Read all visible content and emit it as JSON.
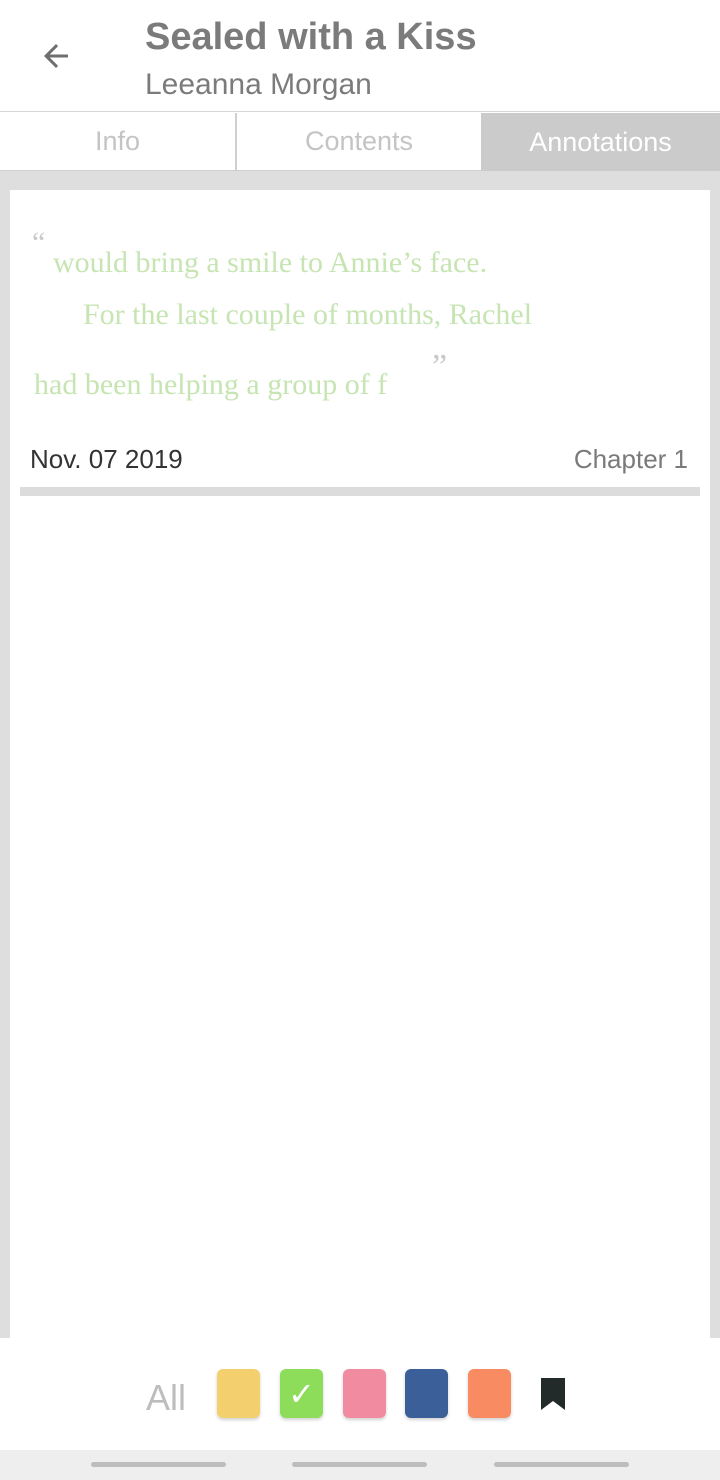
{
  "header": {
    "title": "Sealed with a Kiss",
    "author": "Leeanna Morgan",
    "back_icon": "arrow-left-icon"
  },
  "tabs": [
    {
      "label": "Info",
      "active": false
    },
    {
      "label": "Contents",
      "active": false
    },
    {
      "label": "Annotations",
      "active": true
    }
  ],
  "annotations": [
    {
      "quote_open": "“",
      "quote_close": "”",
      "lines": [
        "would bring a smile to Annie’s face.",
        "For the last couple of months, Rachel",
        "had been helping a group of f"
      ],
      "highlight_color": "#c6e5b2",
      "date": "Nov. 07 2019",
      "chapter": "Chapter 1"
    }
  ],
  "filter": {
    "all_label": "All",
    "colors": [
      {
        "name": "yellow",
        "hex": "#f3cf6e",
        "selected": false
      },
      {
        "name": "green",
        "hex": "#8ddd5a",
        "selected": true
      },
      {
        "name": "pink",
        "hex": "#f18ba0",
        "selected": false
      },
      {
        "name": "blue",
        "hex": "#3b6099",
        "selected": false
      },
      {
        "name": "orange",
        "hex": "#f98b63",
        "selected": false
      }
    ],
    "check_glyph": "✓",
    "bookmark_icon": "bookmark-icon",
    "bookmark_color": "#222a2a"
  }
}
